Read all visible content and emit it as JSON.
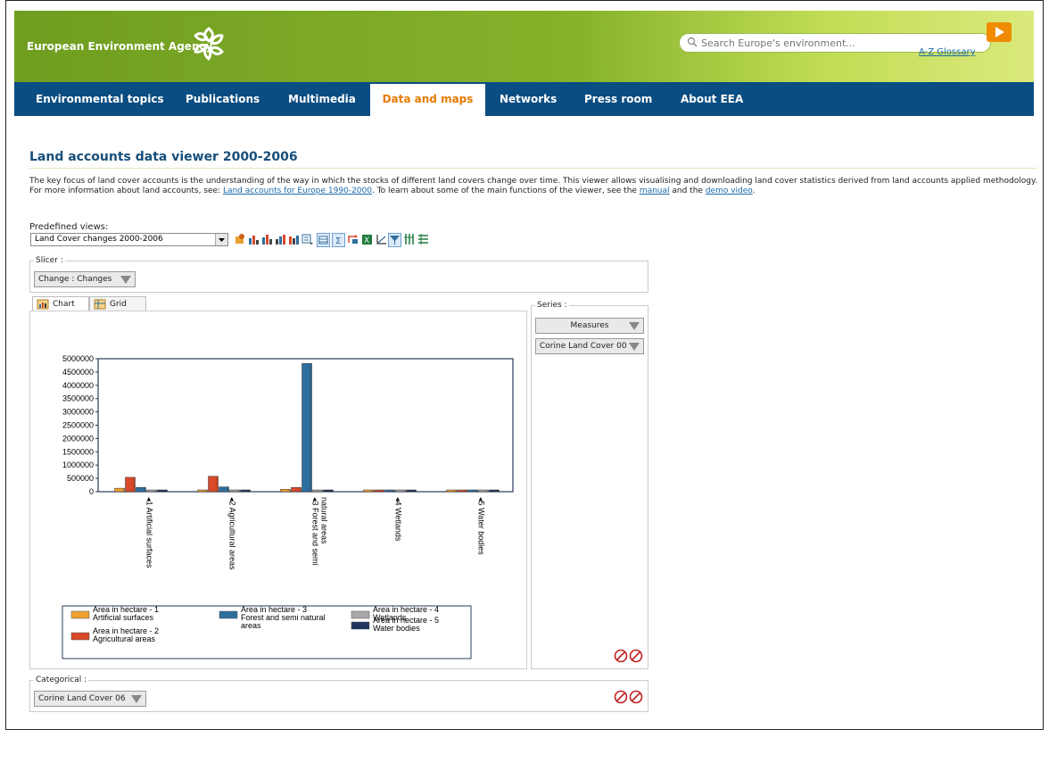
{
  "header": {
    "logo_text": "European Environment Agency",
    "search_placeholder": "Search Europe's environment...",
    "glossary_link": "A-Z Glossary"
  },
  "nav": {
    "items": [
      {
        "label": "Environmental topics"
      },
      {
        "label": "Publications"
      },
      {
        "label": "Multimedia"
      },
      {
        "label": "Data and maps",
        "active": true
      },
      {
        "label": "Networks"
      },
      {
        "label": "Press room"
      },
      {
        "label": "About EEA"
      }
    ]
  },
  "page": {
    "title": "Land accounts data viewer 2000-2006",
    "intro_part1": "The key focus of land cover accounts is the understanding of the way in which the stocks of different land covers change over time. This viewer allows visualising and downloading land cover statistics derived from land accounts applied methodology. For more information about land accounts, see: ",
    "intro_link1": "Land accounts for Europe 1990-2000",
    "intro_part2": ". To learn about some of the main functions of the viewer, see the ",
    "intro_link2": "manual",
    "intro_part3": " and the ",
    "intro_link3": "demo video",
    "intro_part4": "."
  },
  "predefined": {
    "label": "Predefined views:",
    "selected": "Land Cover changes 2000-2006"
  },
  "slicer": {
    "legend": "Slicer :",
    "dropdown": "Change : Changes"
  },
  "tabs": {
    "chart": "Chart",
    "grid": "Grid"
  },
  "series_panel": {
    "legend": "Series :",
    "dropdown1": "Measures",
    "dropdown2": "Corine Land Cover 00"
  },
  "categorical": {
    "legend": "Categorical :",
    "dropdown": "Corine Land Cover 06"
  },
  "colors": {
    "series1": "#f0a030",
    "series2": "#d84a2a",
    "series3": "#2e6e9e",
    "series4": "#a8a8a8",
    "series5": "#1f3560"
  },
  "chart_data": {
    "type": "bar",
    "categories": [
      "◂1 Artificial surfaces",
      "◂2 Agricultural areas",
      "◂3 Forest and semi natural areas",
      "◂4 Wetlands",
      "◂5 Water bodies"
    ],
    "series": [
      {
        "name": "Area in hectare - 1 Artificial surfaces",
        "values": [
          130000,
          60000,
          90000,
          30000,
          30000
        ]
      },
      {
        "name": "Area in hectare - 2 Agricultural areas",
        "values": [
          540000,
          580000,
          160000,
          40000,
          40000
        ]
      },
      {
        "name": "Area in hectare - 3 Forest and semi natural areas",
        "values": [
          160000,
          180000,
          4820000,
          50000,
          50000
        ]
      },
      {
        "name": "Area in hectare - 4 Wetlands",
        "values": [
          40000,
          40000,
          50000,
          30000,
          30000
        ]
      },
      {
        "name": "Area in hectare - 5 Water bodies",
        "values": [
          30000,
          30000,
          40000,
          30000,
          30000
        ]
      }
    ],
    "ylim": [
      0,
      5000000
    ],
    "yticks": [
      "5000000",
      "4500000",
      "4000000",
      "3500000",
      "3000000",
      "2500000",
      "2000000",
      "1500000",
      "1000000",
      "500000",
      "0"
    ],
    "legend_placement": "bottom",
    "grid": false
  }
}
